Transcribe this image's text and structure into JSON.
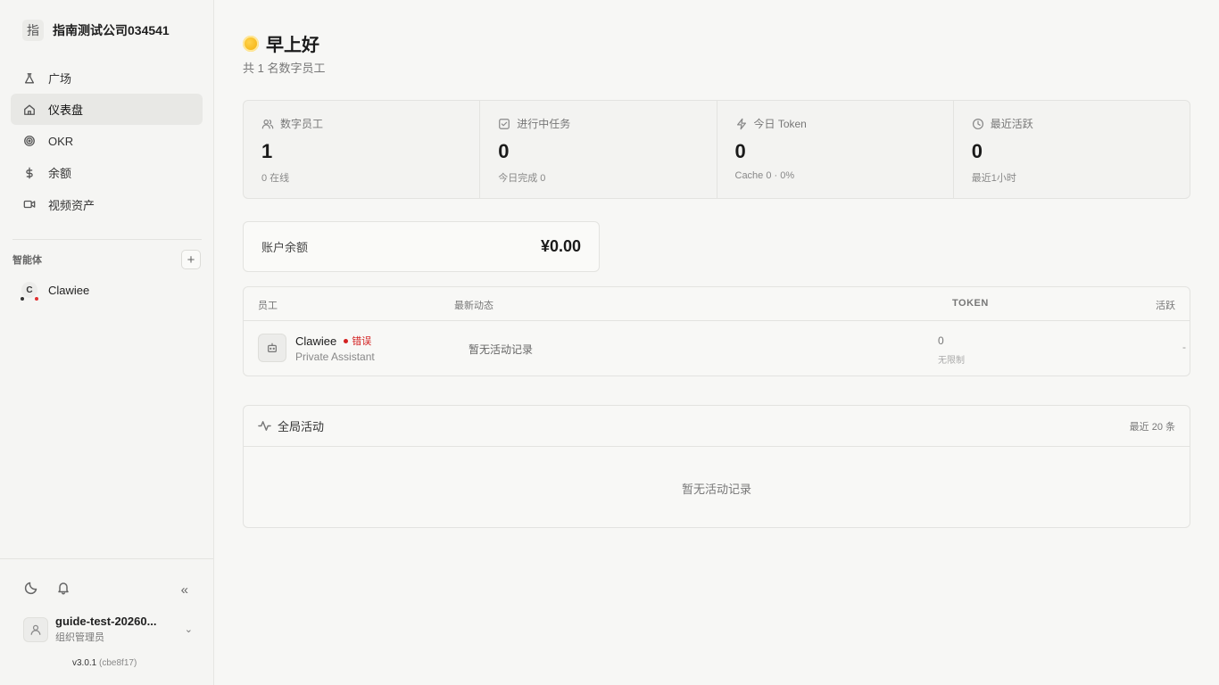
{
  "org": {
    "logo_char": "指",
    "name": "指南测试公司034541"
  },
  "nav": [
    {
      "label": "广场",
      "icon": "flask-icon",
      "active": false
    },
    {
      "label": "仪表盘",
      "icon": "home-icon",
      "active": true
    },
    {
      "label": "OKR",
      "icon": "target-icon",
      "active": false
    },
    {
      "label": "余额",
      "icon": "dollar-icon",
      "active": false
    },
    {
      "label": "视频资产",
      "icon": "video-icon",
      "active": false
    }
  ],
  "agents_section": {
    "label": "智能体",
    "add_label": "+"
  },
  "agents": [
    {
      "initial": "C",
      "name": "Clawiee"
    }
  ],
  "sidebar_bottom": {
    "collapse_label": "«"
  },
  "user": {
    "name": "guide-test-20260...",
    "role": "组织管理员",
    "chevron": "⌄"
  },
  "version": {
    "number": "v3.0.1",
    "hash": "(cbe8f17)"
  },
  "header": {
    "greeting": "早上好",
    "subtitle": "共 1 名数字员工"
  },
  "stats": [
    {
      "label": "数字员工",
      "icon": "users-icon",
      "value": "1",
      "sub": "0 在线"
    },
    {
      "label": "进行中任务",
      "icon": "checkbox-icon",
      "value": "0",
      "sub": "今日完成 0"
    },
    {
      "label": "今日 Token",
      "icon": "lightning-icon",
      "value": "0",
      "sub": "Cache 0 · 0%"
    },
    {
      "label": "最近活跃",
      "icon": "clock-icon",
      "value": "0",
      "sub": "最近1小时"
    }
  ],
  "balance": {
    "label": "账户余额",
    "value": "¥0.00"
  },
  "employees_table": {
    "headers": {
      "employee": "员工",
      "latest": "最新动态",
      "token": "TOKEN",
      "active": "活跃"
    },
    "rows": [
      {
        "name": "Clawiee",
        "status": "错误",
        "role": "Private Assistant",
        "activity": "暂无活动记录",
        "token": "0",
        "token_limit": "无限制",
        "active": "-"
      }
    ]
  },
  "global_activity": {
    "title": "全局活动",
    "count": "最近 20 条",
    "empty": "暂无活动记录"
  },
  "colors": {
    "error": "#d32020",
    "sidebar_bg": "#f5f5f3",
    "page_bg": "#f7f7f5"
  }
}
